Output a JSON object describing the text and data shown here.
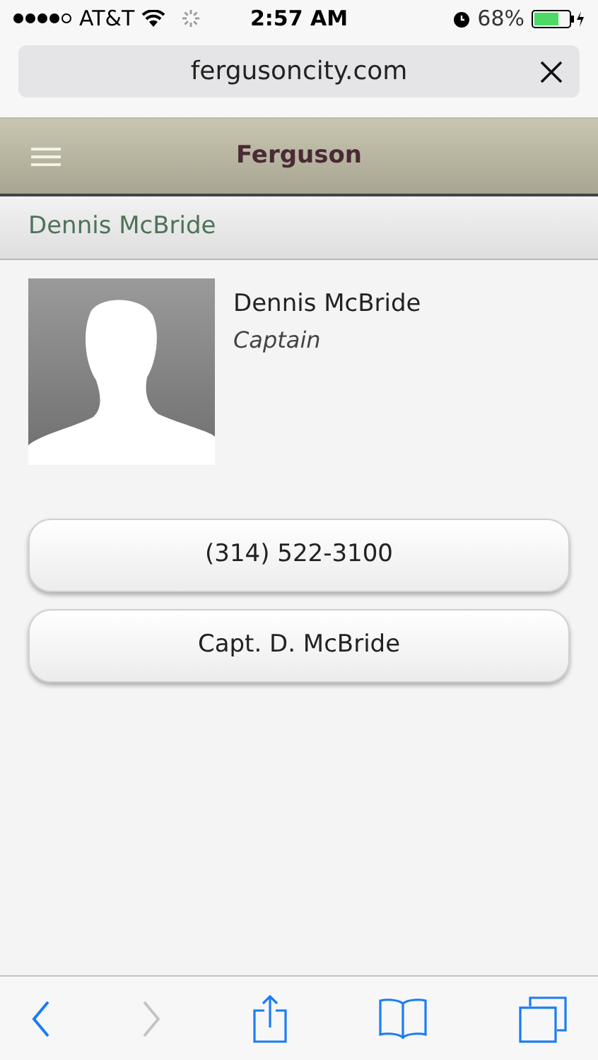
{
  "status_bar": {
    "carrier": "AT&T",
    "time": "2:57 AM",
    "battery": "68%"
  },
  "address_bar": {
    "url": "fergusoncity.com"
  },
  "header": {
    "title": "Ferguson"
  },
  "section": {
    "title": "Dennis McBride"
  },
  "profile": {
    "name": "Dennis McBride",
    "role": "Captain"
  },
  "actions": [
    {
      "label": "(314) 522-3100"
    },
    {
      "label": "Capt. D. McBride"
    }
  ],
  "toolbar": [
    {
      "kind": "back",
      "disabled": false
    },
    {
      "kind": "forward",
      "disabled": true
    },
    {
      "kind": "share",
      "disabled": false
    },
    {
      "kind": "bookmarks",
      "disabled": false
    },
    {
      "kind": "tabs",
      "disabled": false
    }
  ]
}
